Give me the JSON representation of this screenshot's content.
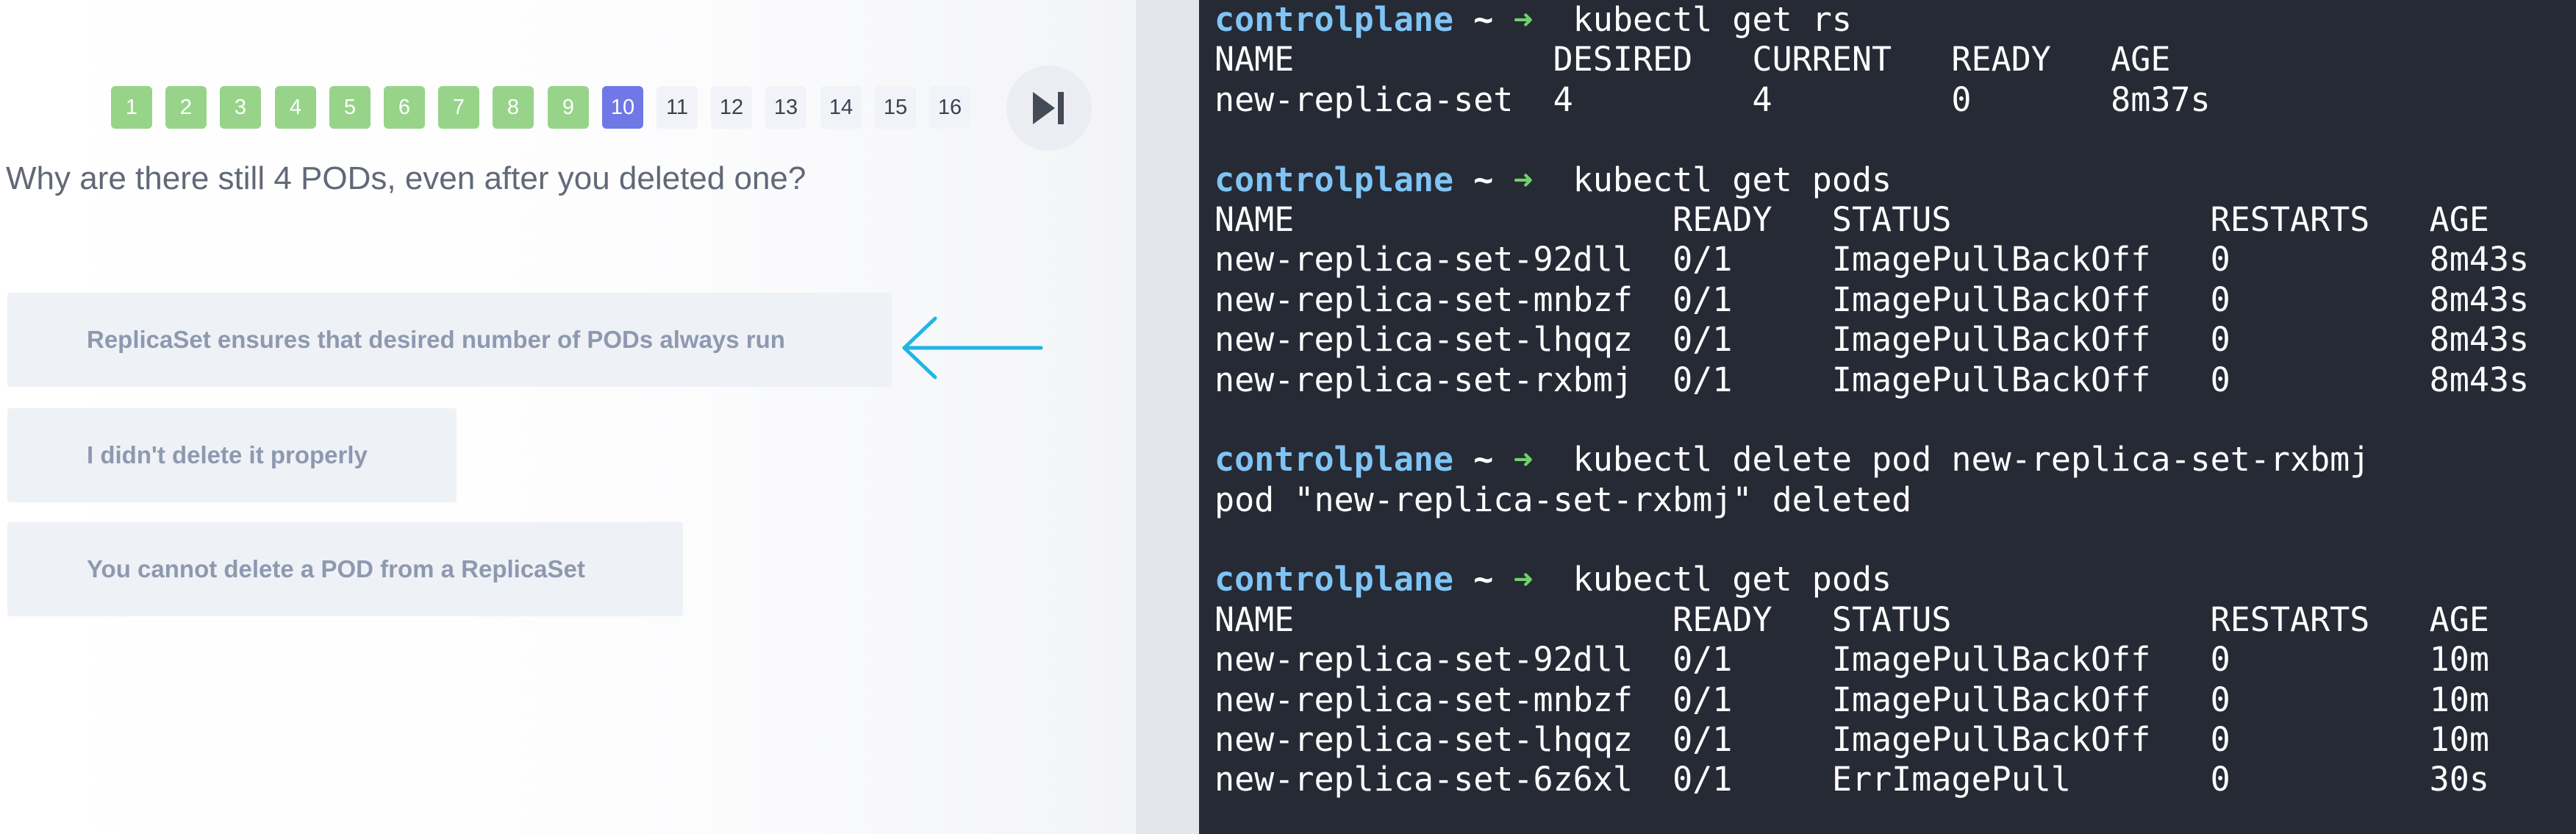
{
  "quiz": {
    "question_numbers": [
      {
        "label": "1",
        "state": "done"
      },
      {
        "label": "2",
        "state": "done"
      },
      {
        "label": "3",
        "state": "done"
      },
      {
        "label": "4",
        "state": "done"
      },
      {
        "label": "5",
        "state": "done"
      },
      {
        "label": "6",
        "state": "done"
      },
      {
        "label": "7",
        "state": "done"
      },
      {
        "label": "8",
        "state": "done"
      },
      {
        "label": "9",
        "state": "done"
      },
      {
        "label": "10",
        "state": "current"
      },
      {
        "label": "11",
        "state": "todo"
      },
      {
        "label": "12",
        "state": "todo"
      },
      {
        "label": "13",
        "state": "todo"
      },
      {
        "label": "14",
        "state": "todo"
      },
      {
        "label": "15",
        "state": "todo"
      },
      {
        "label": "16",
        "state": "todo"
      }
    ],
    "skip_icon": "skip-to-end-icon",
    "question": "Why are there still 4 PODs, even after you deleted one?",
    "options": [
      "ReplicaSet ensures that desired number of PODs always run",
      "I didn't delete it properly",
      "You cannot delete a POD from a ReplicaSet"
    ],
    "annotation_icon": "arrow-left-icon",
    "colors": {
      "done": "#97d48a",
      "current": "#7077e6",
      "todo": "#f1f3f8",
      "arrow": "#1fb6e3",
      "terminal_bg": "#262a35",
      "prompt_user": "#7fc4f5",
      "prompt_arrow": "#6fd16a"
    }
  },
  "terminal": {
    "prompt_user": "controlplane",
    "prompt_tilde": "~",
    "prompt_arrow": "➜",
    "lines": [
      {
        "kind": "cmd",
        "text": "kubectl get rs"
      },
      {
        "kind": "out",
        "text": "NAME             DESIRED   CURRENT   READY   AGE"
      },
      {
        "kind": "out",
        "text": "new-replica-set  4         4         0       8m37s"
      },
      {
        "kind": "blank",
        "text": ""
      },
      {
        "kind": "cmd",
        "text": "kubectl get pods"
      },
      {
        "kind": "out",
        "text": "NAME                   READY   STATUS             RESTARTS   AGE"
      },
      {
        "kind": "out",
        "text": "new-replica-set-92dll  0/1     ImagePullBackOff   0          8m43s"
      },
      {
        "kind": "out",
        "text": "new-replica-set-mnbzf  0/1     ImagePullBackOff   0          8m43s"
      },
      {
        "kind": "out",
        "text": "new-replica-set-lhqqz  0/1     ImagePullBackOff   0          8m43s"
      },
      {
        "kind": "out",
        "text": "new-replica-set-rxbmj  0/1     ImagePullBackOff   0          8m43s"
      },
      {
        "kind": "blank",
        "text": ""
      },
      {
        "kind": "cmd",
        "text": "kubectl delete pod new-replica-set-rxbmj"
      },
      {
        "kind": "out",
        "text": "pod \"new-replica-set-rxbmj\" deleted"
      },
      {
        "kind": "blank",
        "text": ""
      },
      {
        "kind": "cmd",
        "text": "kubectl get pods"
      },
      {
        "kind": "out",
        "text": "NAME                   READY   STATUS             RESTARTS   AGE"
      },
      {
        "kind": "out",
        "text": "new-replica-set-92dll  0/1     ImagePullBackOff   0          10m"
      },
      {
        "kind": "out",
        "text": "new-replica-set-mnbzf  0/1     ImagePullBackOff   0          10m"
      },
      {
        "kind": "out",
        "text": "new-replica-set-lhqqz  0/1     ImagePullBackOff   0          10m"
      },
      {
        "kind": "out",
        "text": "new-replica-set-6z6xl  0/1     ErrImagePull       0          30s"
      }
    ]
  }
}
